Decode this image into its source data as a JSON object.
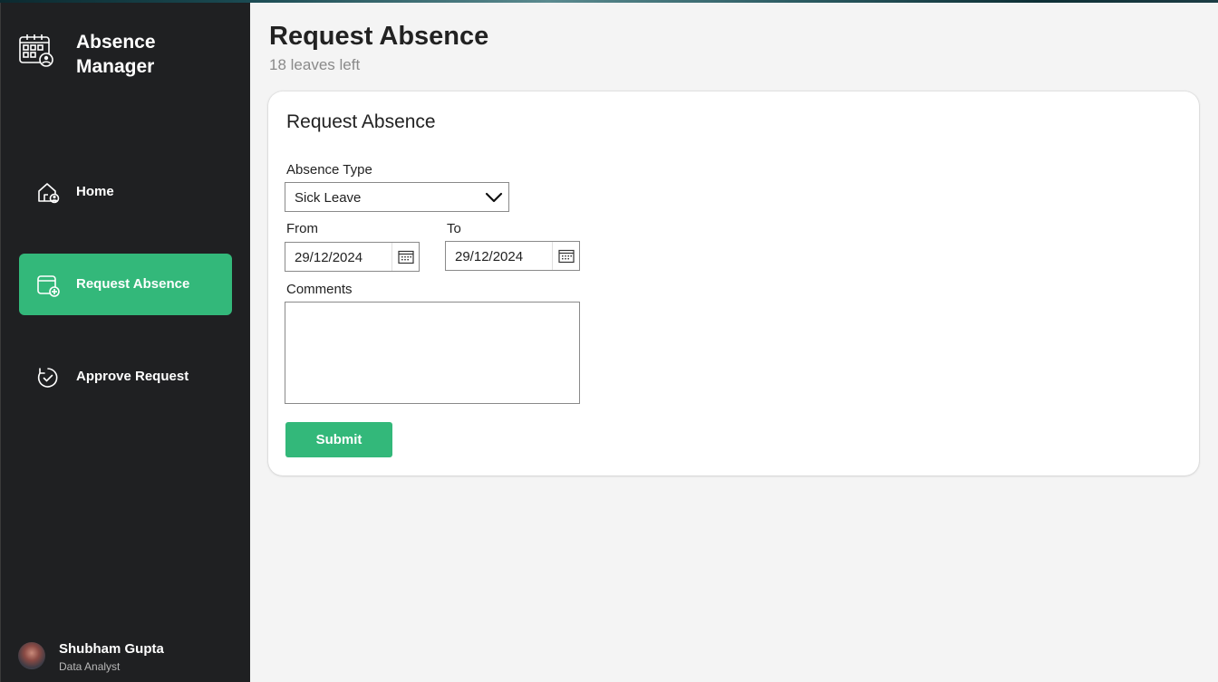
{
  "app": {
    "title": "Absence Manager",
    "title_line1": "Absence",
    "title_line2": "Manager",
    "brand_icon": "calendar-person-icon"
  },
  "sidebar": {
    "items": [
      {
        "label": "Home",
        "icon": "home-person-icon",
        "active": false
      },
      {
        "label": "Request Absence",
        "icon": "calendar-add-icon",
        "active": true
      },
      {
        "label": "Approve Request",
        "icon": "check-refresh-icon",
        "active": false
      }
    ],
    "user": {
      "name": "Shubham Gupta",
      "role": "Data Analyst"
    }
  },
  "header": {
    "title": "Request Absence",
    "subtitle": "18 leaves left"
  },
  "form": {
    "title": "Request Absence",
    "absence_type_label": "Absence Type",
    "absence_type_value": "Sick Leave",
    "from_label": "From",
    "from_value": "29/12/2024",
    "to_label": "To",
    "to_value": "29/12/2024",
    "comments_label": "Comments",
    "comments_value": "",
    "submit_label": "Submit"
  },
  "colors": {
    "accent": "#33b87a",
    "sidebar_bg": "#1f2022",
    "page_bg": "#f4f4f4"
  }
}
